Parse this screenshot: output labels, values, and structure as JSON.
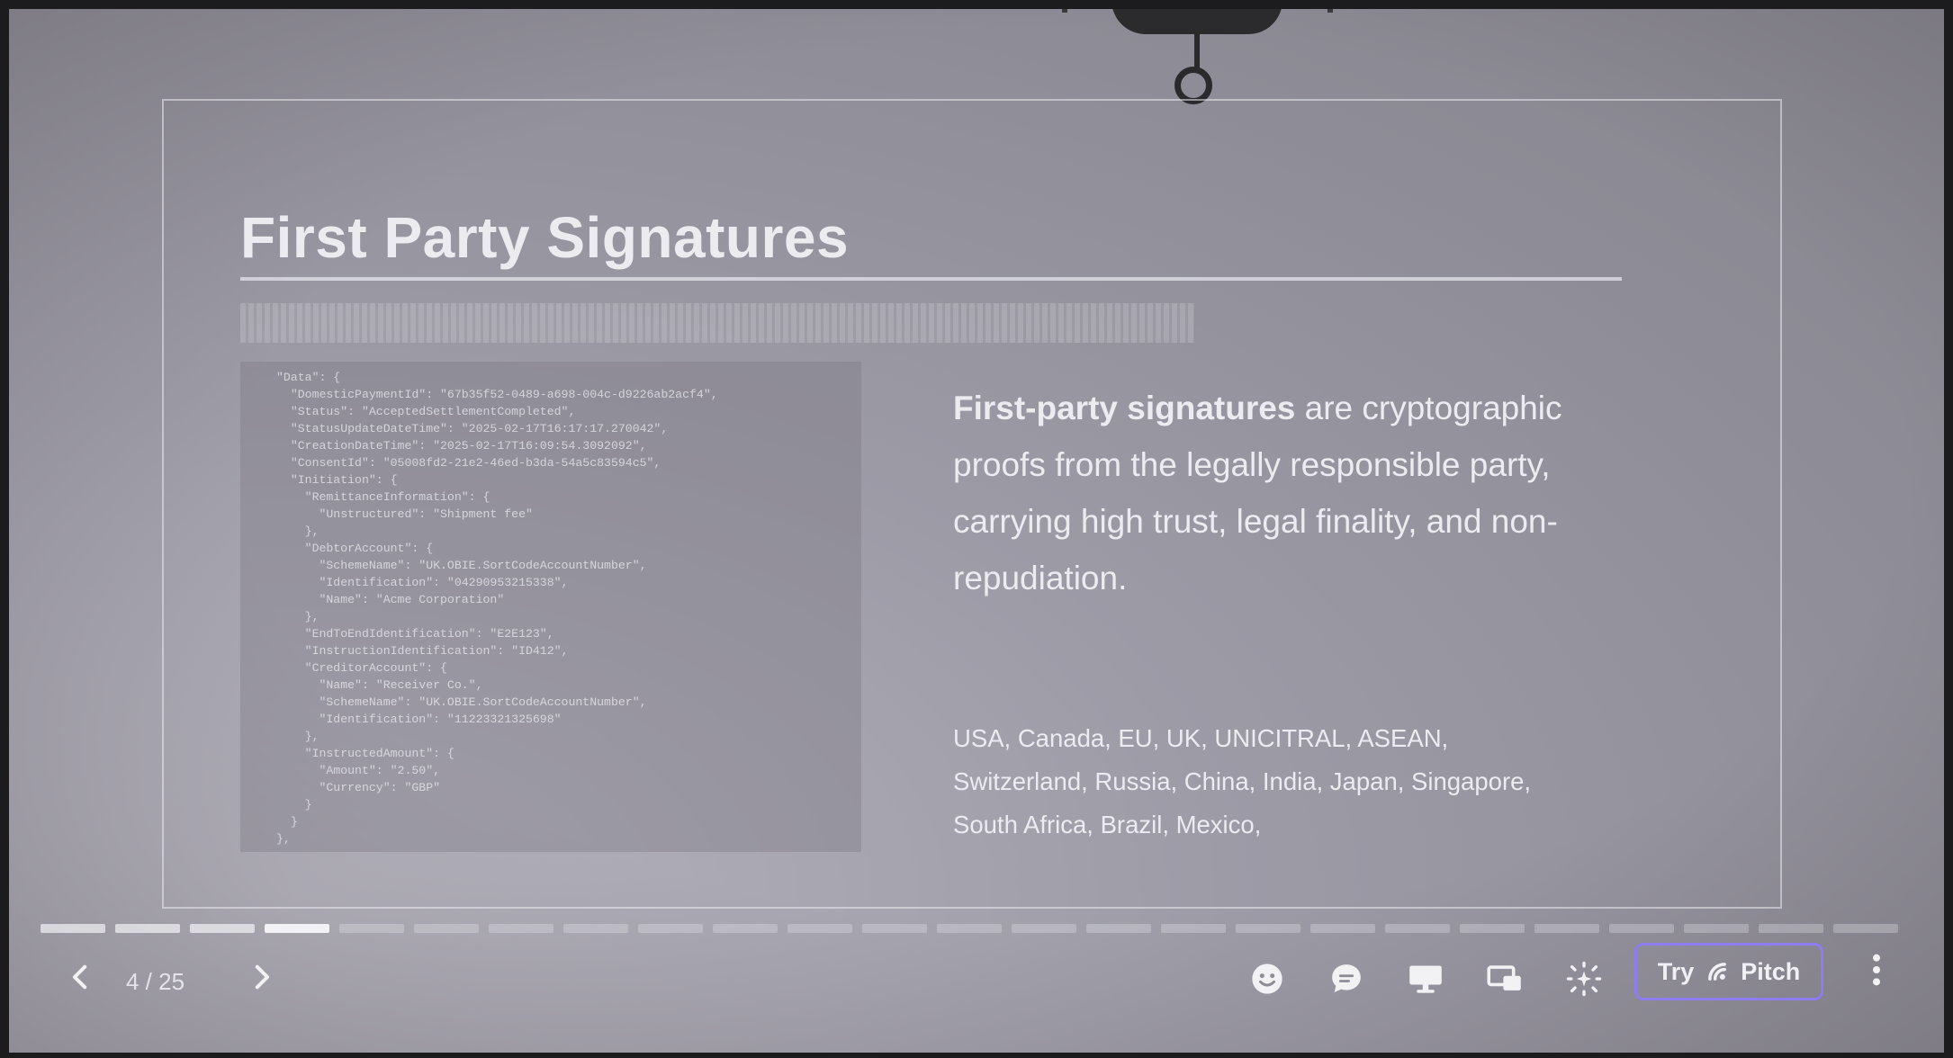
{
  "slide": {
    "title": "First Party Signatures",
    "code_sample": "\"Data\": {\n  \"DomesticPaymentId\": \"67b35f52-0489-a698-004c-d9226ab2acf4\",\n  \"Status\": \"AcceptedSettlementCompleted\",\n  \"StatusUpdateDateTime\": \"2025-02-17T16:17:17.270042\",\n  \"CreationDateTime\": \"2025-02-17T16:09:54.3092092\",\n  \"ConsentId\": \"05008fd2-21e2-46ed-b3da-54a5c83594c5\",\n  \"Initiation\": {\n    \"RemittanceInformation\": {\n      \"Unstructured\": \"Shipment fee\"\n    },\n    \"DebtorAccount\": {\n      \"SchemeName\": \"UK.OBIE.SortCodeAccountNumber\",\n      \"Identification\": \"04290953215338\",\n      \"Name\": \"Acme Corporation\"\n    },\n    \"EndToEndIdentification\": \"E2E123\",\n    \"InstructionIdentification\": \"ID412\",\n    \"CreditorAccount\": {\n      \"Name\": \"Receiver Co.\",\n      \"SchemeName\": \"UK.OBIE.SortCodeAccountNumber\",\n      \"Identification\": \"11223321325698\"\n    },\n    \"InstructedAmount\": {\n      \"Amount\": \"2.50\",\n      \"Currency\": \"GBP\"\n    }\n  }\n},",
    "description_bold": "First-party signatures",
    "description_rest": " are cryptographic proofs from the legally responsible party, carrying high trust, legal finality, and non-repudiation.",
    "jurisdictions": "USA, Canada, EU, UK, UNICITRAL, ASEAN, Switzerland, Russia, China, India, Japan, Singapore, South Africa, Brazil, Mexico,"
  },
  "controls": {
    "prev_icon": "chevron-left-icon",
    "next_icon": "chevron-right-icon",
    "counter": "4 / 25",
    "current_slide": 4,
    "total_slides": 25,
    "tools": [
      "emoji-reaction-icon",
      "comment-icon",
      "presenter-view-icon",
      "screen-share-icon",
      "sparkle-ai-icon"
    ],
    "try_label": "Try",
    "pitch_label": "Pitch",
    "more_icon": "more-vertical-icon",
    "accent_color": "#8d7df0"
  }
}
